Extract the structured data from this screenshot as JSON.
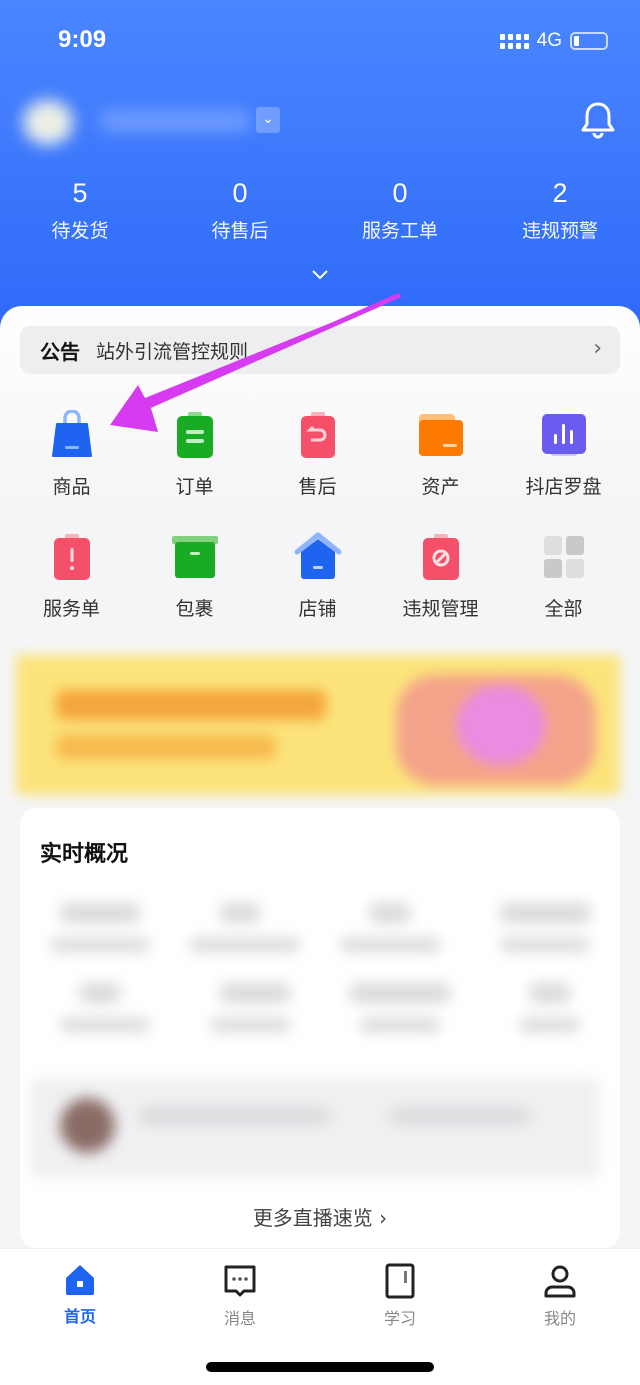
{
  "status_bar": {
    "time": "9:09",
    "network": "4G"
  },
  "header": {
    "stats": [
      {
        "value": "5",
        "label": "待发货"
      },
      {
        "value": "0",
        "label": "待售后"
      },
      {
        "value": "0",
        "label": "服务工单"
      },
      {
        "value": "2",
        "label": "违规预警"
      }
    ]
  },
  "notice": {
    "tag": "公告",
    "text": "站外引流管控规则"
  },
  "shortcuts": [
    {
      "label": "商品",
      "icon": "shopping-bag-icon",
      "color": "#1e64f0"
    },
    {
      "label": "订单",
      "icon": "order-clipboard-icon",
      "color": "#1aab24"
    },
    {
      "label": "售后",
      "icon": "after-sales-icon",
      "color": "#f5506a"
    },
    {
      "label": "资产",
      "icon": "wallet-icon",
      "color": "#ff7a00"
    },
    {
      "label": "抖店罗盘",
      "icon": "chart-icon",
      "color": "#6b5cf0"
    },
    {
      "label": "服务单",
      "icon": "alert-clipboard-icon",
      "color": "#f5506a"
    },
    {
      "label": "包裹",
      "icon": "package-box-icon",
      "color": "#1aab24"
    },
    {
      "label": "店铺",
      "icon": "store-house-icon",
      "color": "#1e64f0"
    },
    {
      "label": "违规管理",
      "icon": "violation-icon",
      "color": "#f5506a"
    },
    {
      "label": "全部",
      "icon": "grid-icon",
      "color": "#cfcfd2"
    }
  ],
  "overview": {
    "title": "实时概况",
    "more_label": "更多直播速览"
  },
  "tabbar": [
    {
      "label": "首页",
      "active": true
    },
    {
      "label": "消息"
    },
    {
      "label": "学习"
    },
    {
      "label": "我的"
    }
  ],
  "colors": {
    "primary": "#1e64f0",
    "annotation_arrow": "#d63bf0"
  }
}
